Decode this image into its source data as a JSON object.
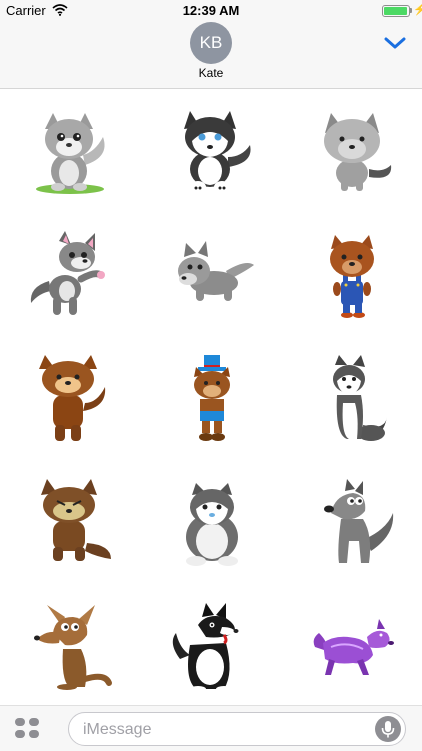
{
  "status": {
    "carrier": "Carrier",
    "time": "12:39 AM",
    "battery_level": 1.0
  },
  "header": {
    "avatar_initials": "KB",
    "contact_name": "Kate"
  },
  "stickers": [
    "gray-wolf-cub-sticker",
    "husky-puppy-sticker",
    "gray-wolf-head-sticker",
    "pink-eared-wolf-sticker",
    "crawling-wolf-sticker",
    "wolf-in-overalls-sticker",
    "brown-werewolf-sticker",
    "wolf-with-top-hat-sticker",
    "sitting-husky-sticker",
    "angry-brown-wolf-sticker",
    "fluffy-gray-pup-sticker",
    "cartoon-gray-wolf-sticker",
    "brown-coyote-sticker",
    "black-white-wolf-sticker",
    "purple-fantasy-wolf-sticker"
  ],
  "input": {
    "placeholder": "iMessage"
  }
}
